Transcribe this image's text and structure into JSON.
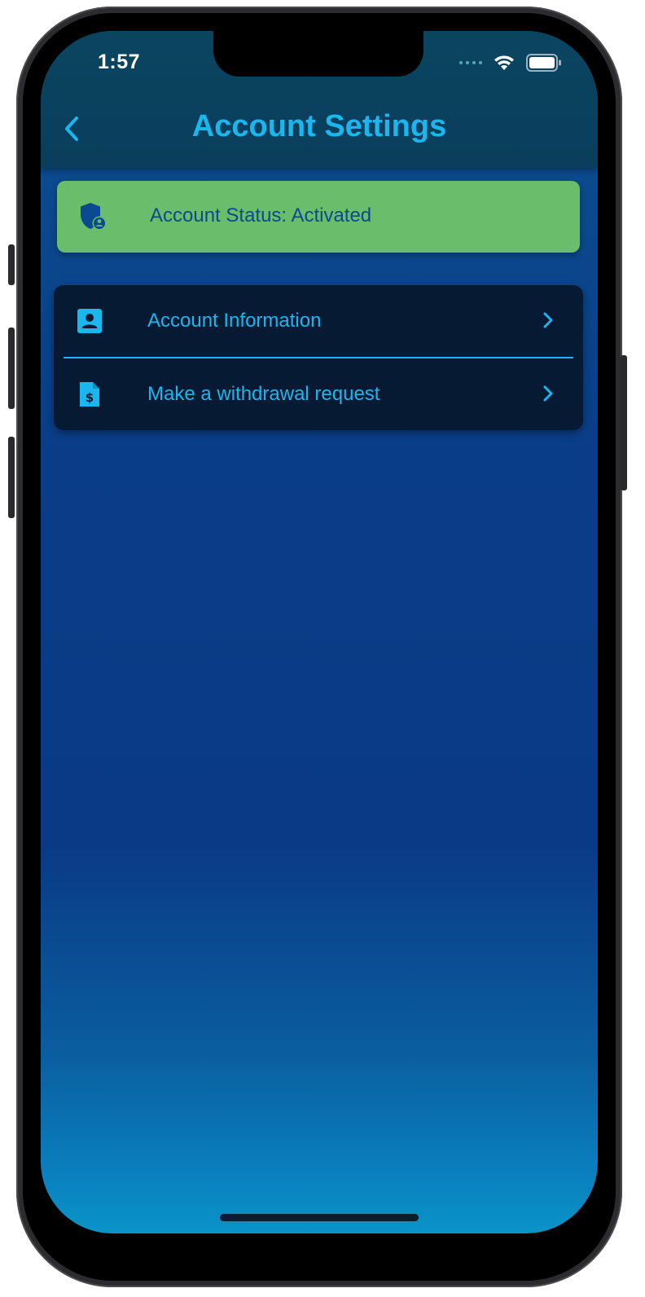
{
  "status_bar": {
    "time": "1:57"
  },
  "header": {
    "title": "Account Settings",
    "back_icon": "chevron-left-icon"
  },
  "account_status": {
    "label": "Account Status: Activated",
    "icon": "shield-user-icon",
    "color": "#69bd6b"
  },
  "menu": {
    "items": [
      {
        "label": "Account Information",
        "icon": "contact-card-icon"
      },
      {
        "label": "Make a withdrawal request",
        "icon": "dollar-document-icon"
      }
    ]
  },
  "colors": {
    "accent": "#1ab6ee",
    "menu_bg": "#071a34",
    "header_bg": "#0a4560"
  }
}
